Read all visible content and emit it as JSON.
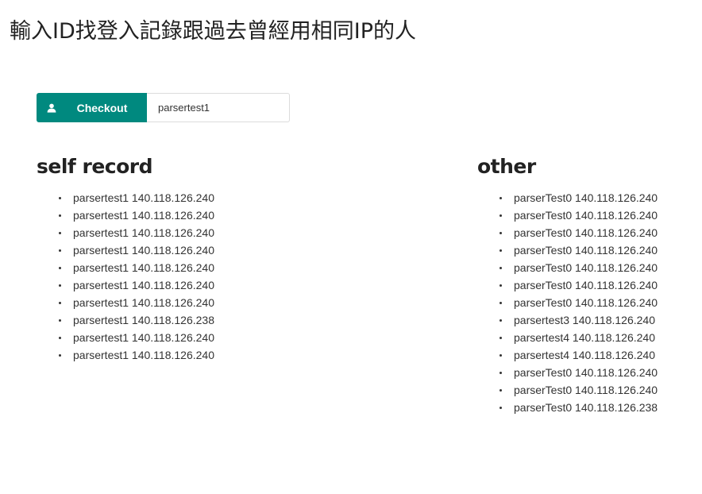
{
  "page": {
    "title": "輸入ID找登入記錄跟過去曾經用相同IP的人"
  },
  "checkout": {
    "button_label": "Checkout",
    "icon": "user-icon",
    "input_value": "parsertest1",
    "accent_color": "#00897f"
  },
  "self_record": {
    "title": "self record",
    "items": [
      "parsertest1 140.118.126.240",
      "parsertest1 140.118.126.240",
      "parsertest1 140.118.126.240",
      "parsertest1 140.118.126.240",
      "parsertest1 140.118.126.240",
      "parsertest1 140.118.126.240",
      "parsertest1 140.118.126.240",
      "parsertest1 140.118.126.238",
      "parsertest1 140.118.126.240",
      "parsertest1 140.118.126.240"
    ]
  },
  "other": {
    "title": "other",
    "items": [
      "parserTest0 140.118.126.240",
      "parserTest0 140.118.126.240",
      "parserTest0 140.118.126.240",
      "parserTest0 140.118.126.240",
      "parserTest0 140.118.126.240",
      "parserTest0 140.118.126.240",
      "parserTest0 140.118.126.240",
      "parsertest3 140.118.126.240",
      "parsertest4 140.118.126.240",
      "parsertest4 140.118.126.240",
      "parserTest0 140.118.126.240",
      "parserTest0 140.118.126.240",
      "parserTest0 140.118.126.238"
    ]
  }
}
